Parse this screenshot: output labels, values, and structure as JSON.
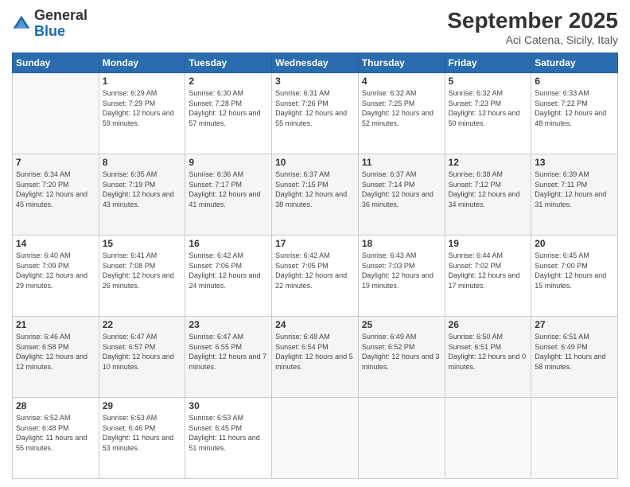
{
  "logo": {
    "general": "General",
    "blue": "Blue"
  },
  "header": {
    "month": "September 2025",
    "location": "Aci Catena, Sicily, Italy"
  },
  "weekdays": [
    "Sunday",
    "Monday",
    "Tuesday",
    "Wednesday",
    "Thursday",
    "Friday",
    "Saturday"
  ],
  "weeks": [
    [
      {
        "day": "",
        "sunrise": "",
        "sunset": "",
        "daylight": ""
      },
      {
        "day": "1",
        "sunrise": "Sunrise: 6:29 AM",
        "sunset": "Sunset: 7:29 PM",
        "daylight": "Daylight: 12 hours and 59 minutes."
      },
      {
        "day": "2",
        "sunrise": "Sunrise: 6:30 AM",
        "sunset": "Sunset: 7:28 PM",
        "daylight": "Daylight: 12 hours and 57 minutes."
      },
      {
        "day": "3",
        "sunrise": "Sunrise: 6:31 AM",
        "sunset": "Sunset: 7:26 PM",
        "daylight": "Daylight: 12 hours and 55 minutes."
      },
      {
        "day": "4",
        "sunrise": "Sunrise: 6:32 AM",
        "sunset": "Sunset: 7:25 PM",
        "daylight": "Daylight: 12 hours and 52 minutes."
      },
      {
        "day": "5",
        "sunrise": "Sunrise: 6:32 AM",
        "sunset": "Sunset: 7:23 PM",
        "daylight": "Daylight: 12 hours and 50 minutes."
      },
      {
        "day": "6",
        "sunrise": "Sunrise: 6:33 AM",
        "sunset": "Sunset: 7:22 PM",
        "daylight": "Daylight: 12 hours and 48 minutes."
      }
    ],
    [
      {
        "day": "7",
        "sunrise": "Sunrise: 6:34 AM",
        "sunset": "Sunset: 7:20 PM",
        "daylight": "Daylight: 12 hours and 45 minutes."
      },
      {
        "day": "8",
        "sunrise": "Sunrise: 6:35 AM",
        "sunset": "Sunset: 7:19 PM",
        "daylight": "Daylight: 12 hours and 43 minutes."
      },
      {
        "day": "9",
        "sunrise": "Sunrise: 6:36 AM",
        "sunset": "Sunset: 7:17 PM",
        "daylight": "Daylight: 12 hours and 41 minutes."
      },
      {
        "day": "10",
        "sunrise": "Sunrise: 6:37 AM",
        "sunset": "Sunset: 7:15 PM",
        "daylight": "Daylight: 12 hours and 38 minutes."
      },
      {
        "day": "11",
        "sunrise": "Sunrise: 6:37 AM",
        "sunset": "Sunset: 7:14 PM",
        "daylight": "Daylight: 12 hours and 36 minutes."
      },
      {
        "day": "12",
        "sunrise": "Sunrise: 6:38 AM",
        "sunset": "Sunset: 7:12 PM",
        "daylight": "Daylight: 12 hours and 34 minutes."
      },
      {
        "day": "13",
        "sunrise": "Sunrise: 6:39 AM",
        "sunset": "Sunset: 7:11 PM",
        "daylight": "Daylight: 12 hours and 31 minutes."
      }
    ],
    [
      {
        "day": "14",
        "sunrise": "Sunrise: 6:40 AM",
        "sunset": "Sunset: 7:09 PM",
        "daylight": "Daylight: 12 hours and 29 minutes."
      },
      {
        "day": "15",
        "sunrise": "Sunrise: 6:41 AM",
        "sunset": "Sunset: 7:08 PM",
        "daylight": "Daylight: 12 hours and 26 minutes."
      },
      {
        "day": "16",
        "sunrise": "Sunrise: 6:42 AM",
        "sunset": "Sunset: 7:06 PM",
        "daylight": "Daylight: 12 hours and 24 minutes."
      },
      {
        "day": "17",
        "sunrise": "Sunrise: 6:42 AM",
        "sunset": "Sunset: 7:05 PM",
        "daylight": "Daylight: 12 hours and 22 minutes."
      },
      {
        "day": "18",
        "sunrise": "Sunrise: 6:43 AM",
        "sunset": "Sunset: 7:03 PM",
        "daylight": "Daylight: 12 hours and 19 minutes."
      },
      {
        "day": "19",
        "sunrise": "Sunrise: 6:44 AM",
        "sunset": "Sunset: 7:02 PM",
        "daylight": "Daylight: 12 hours and 17 minutes."
      },
      {
        "day": "20",
        "sunrise": "Sunrise: 6:45 AM",
        "sunset": "Sunset: 7:00 PM",
        "daylight": "Daylight: 12 hours and 15 minutes."
      }
    ],
    [
      {
        "day": "21",
        "sunrise": "Sunrise: 6:46 AM",
        "sunset": "Sunset: 6:58 PM",
        "daylight": "Daylight: 12 hours and 12 minutes."
      },
      {
        "day": "22",
        "sunrise": "Sunrise: 6:47 AM",
        "sunset": "Sunset: 6:57 PM",
        "daylight": "Daylight: 12 hours and 10 minutes."
      },
      {
        "day": "23",
        "sunrise": "Sunrise: 6:47 AM",
        "sunset": "Sunset: 6:55 PM",
        "daylight": "Daylight: 12 hours and 7 minutes."
      },
      {
        "day": "24",
        "sunrise": "Sunrise: 6:48 AM",
        "sunset": "Sunset: 6:54 PM",
        "daylight": "Daylight: 12 hours and 5 minutes."
      },
      {
        "day": "25",
        "sunrise": "Sunrise: 6:49 AM",
        "sunset": "Sunset: 6:52 PM",
        "daylight": "Daylight: 12 hours and 3 minutes."
      },
      {
        "day": "26",
        "sunrise": "Sunrise: 6:50 AM",
        "sunset": "Sunset: 6:51 PM",
        "daylight": "Daylight: 12 hours and 0 minutes."
      },
      {
        "day": "27",
        "sunrise": "Sunrise: 6:51 AM",
        "sunset": "Sunset: 6:49 PM",
        "daylight": "Daylight: 11 hours and 58 minutes."
      }
    ],
    [
      {
        "day": "28",
        "sunrise": "Sunrise: 6:52 AM",
        "sunset": "Sunset: 6:48 PM",
        "daylight": "Daylight: 11 hours and 55 minutes."
      },
      {
        "day": "29",
        "sunrise": "Sunrise: 6:53 AM",
        "sunset": "Sunset: 6:46 PM",
        "daylight": "Daylight: 11 hours and 53 minutes."
      },
      {
        "day": "30",
        "sunrise": "Sunrise: 6:53 AM",
        "sunset": "Sunset: 6:45 PM",
        "daylight": "Daylight: 11 hours and 51 minutes."
      },
      {
        "day": "",
        "sunrise": "",
        "sunset": "",
        "daylight": ""
      },
      {
        "day": "",
        "sunrise": "",
        "sunset": "",
        "daylight": ""
      },
      {
        "day": "",
        "sunrise": "",
        "sunset": "",
        "daylight": ""
      },
      {
        "day": "",
        "sunrise": "",
        "sunset": "",
        "daylight": ""
      }
    ]
  ]
}
